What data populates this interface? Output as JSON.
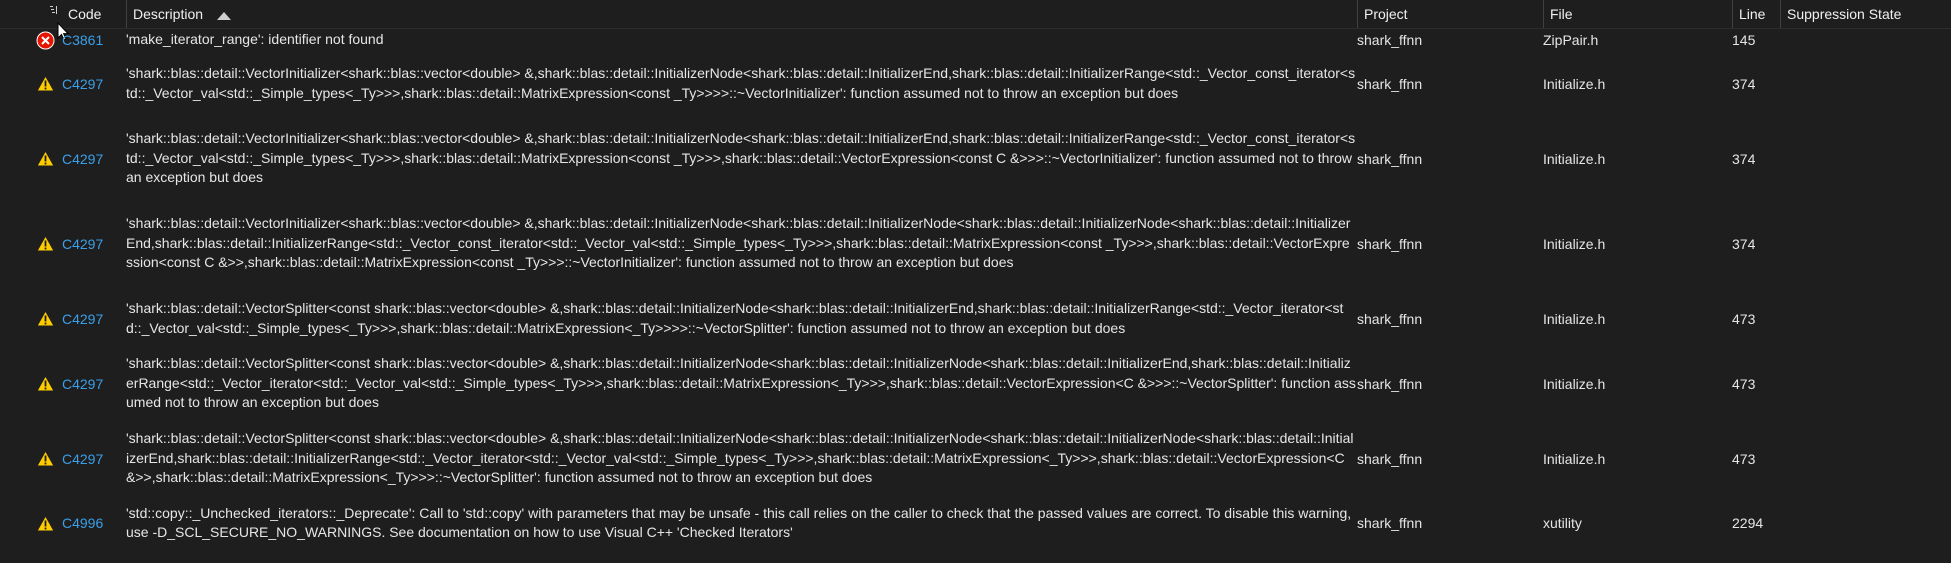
{
  "columns": {
    "code": "Code",
    "description": "Description",
    "project": "Project",
    "file": "File",
    "line": "Line",
    "suppression": "Suppression State"
  },
  "rows": [
    {
      "severity": "error-icon",
      "code": "C3861",
      "description": "'make_iterator_range': identifier not found",
      "project": "shark_ffnn",
      "file": "ZipPair.h",
      "line": "145",
      "suppression": ""
    },
    {
      "severity": "warning-icon",
      "code": "C4297",
      "description": "'shark::blas::detail::VectorInitializer<shark::blas::vector<double> &,shark::blas::detail::InitializerNode<shark::blas::detail::InitializerEnd,shark::blas::detail::InitializerRange<std::_Vector_const_iterator<std::_Vector_val<std::_Simple_types<_Ty>>>,shark::blas::detail::MatrixExpression<const _Ty>>>>::~VectorInitializer': function assumed not to throw an exception but does",
      "project": "shark_ffnn",
      "file": "Initialize.h",
      "line": "374",
      "suppression": ""
    },
    {
      "severity": "warning-icon",
      "code": "C4297",
      "description": "'shark::blas::detail::VectorInitializer<shark::blas::vector<double> &,shark::blas::detail::InitializerNode<shark::blas::detail::InitializerEnd,shark::blas::detail::InitializerRange<std::_Vector_const_iterator<std::_Vector_val<std::_Simple_types<_Ty>>>,shark::blas::detail::MatrixExpression<const _Ty>>>,shark::blas::detail::VectorExpression<const C &>>>::~VectorInitializer': function assumed not to throw an exception but does",
      "project": "shark_ffnn",
      "file": "Initialize.h",
      "line": "374",
      "suppression": ""
    },
    {
      "severity": "warning-icon",
      "code": "C4297",
      "description": "'shark::blas::detail::VectorInitializer<shark::blas::vector<double> &,shark::blas::detail::InitializerNode<shark::blas::detail::InitializerNode<shark::blas::detail::InitializerNode<shark::blas::detail::InitializerEnd,shark::blas::detail::InitializerRange<std::_Vector_const_iterator<std::_Vector_val<std::_Simple_types<_Ty>>>,shark::blas::detail::MatrixExpression<const _Ty>>>,shark::blas::detail::VectorExpression<const C &>>,shark::blas::detail::MatrixExpression<const _Ty>>>::~VectorInitializer': function assumed not to throw an exception but does",
      "project": "shark_ffnn",
      "file": "Initialize.h",
      "line": "374",
      "suppression": ""
    },
    {
      "severity": "warning-icon",
      "code": "C4297",
      "description": "'shark::blas::detail::VectorSplitter<const shark::blas::vector<double> &,shark::blas::detail::InitializerNode<shark::blas::detail::InitializerEnd,shark::blas::detail::InitializerRange<std::_Vector_iterator<std::_Vector_val<std::_Simple_types<_Ty>>>,shark::blas::detail::MatrixExpression<_Ty>>>>::~VectorSplitter': function assumed not to throw an exception but does",
      "project": "shark_ffnn",
      "file": "Initialize.h",
      "line": "473",
      "suppression": ""
    },
    {
      "severity": "warning-icon",
      "code": "C4297",
      "description": "'shark::blas::detail::VectorSplitter<const shark::blas::vector<double> &,shark::blas::detail::InitializerNode<shark::blas::detail::InitializerNode<shark::blas::detail::InitializerEnd,shark::blas::detail::InitializerRange<std::_Vector_iterator<std::_Vector_val<std::_Simple_types<_Ty>>>,shark::blas::detail::MatrixExpression<_Ty>>>,shark::blas::detail::VectorExpression<C &>>>::~VectorSplitter': function assumed not to throw an exception but does",
      "project": "shark_ffnn",
      "file": "Initialize.h",
      "line": "473",
      "suppression": ""
    },
    {
      "severity": "warning-icon",
      "code": "C4297",
      "description": "'shark::blas::detail::VectorSplitter<const shark::blas::vector<double> &,shark::blas::detail::InitializerNode<shark::blas::detail::InitializerNode<shark::blas::detail::InitializerNode<shark::blas::detail::InitializerEnd,shark::blas::detail::InitializerRange<std::_Vector_iterator<std::_Vector_val<std::_Simple_types<_Ty>>>,shark::blas::detail::MatrixExpression<_Ty>>>,shark::blas::detail::VectorExpression<C &>>,shark::blas::detail::MatrixExpression<_Ty>>>::~VectorSplitter': function assumed not to throw an exception but does",
      "project": "shark_ffnn",
      "file": "Initialize.h",
      "line": "473",
      "suppression": ""
    },
    {
      "severity": "warning-icon",
      "code": "C4996",
      "description": "'std::copy::_Unchecked_iterators::_Deprecate': Call to 'std::copy' with parameters that may be unsafe - this call relies on the caller to check that the passed values are correct. To disable this warning, use -D_SCL_SECURE_NO_WARNINGS. See documentation on how to use Visual C++ 'Checked Iterators'",
      "project": "shark_ffnn",
      "file": "xutility",
      "line": "2294",
      "suppression": ""
    }
  ],
  "colors": {
    "background": "#1e1e1e",
    "text": "#e6e6e6",
    "link": "#3b9fe8",
    "error": "#e51400",
    "warning": "#ffcc00"
  }
}
